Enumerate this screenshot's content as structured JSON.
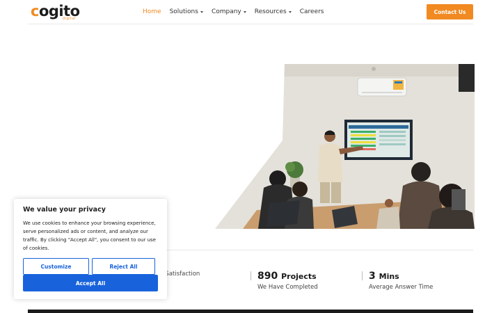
{
  "header": {
    "logo": "cogito",
    "logo_tag": "digital",
    "nav": [
      {
        "label": "Home",
        "active": true,
        "has_dropdown": false
      },
      {
        "label": "Solutions",
        "active": false,
        "has_dropdown": true
      },
      {
        "label": "Company",
        "active": false,
        "has_dropdown": true
      },
      {
        "label": "Resources",
        "active": false,
        "has_dropdown": true
      },
      {
        "label": "Careers",
        "active": false,
        "has_dropdown": false
      }
    ],
    "contact_label": "Contact Us"
  },
  "hero": {
    "image_icon": "office-meeting-photo"
  },
  "stats": [
    {
      "number": "",
      "unit": "",
      "label": "er Satisfaction"
    },
    {
      "number": "890",
      "unit": "Projects",
      "label": "We Have Completed"
    },
    {
      "number": "3",
      "unit": "Mins",
      "label": "Average Answer Time"
    }
  ],
  "cookie": {
    "title": "We value your privacy",
    "text": "We use cookies to enhance your browsing experience, serve personalized ads or content, and analyze our traffic. By clicking \"Accept All\", you consent to our use of cookies.",
    "customize_label": "Customize",
    "reject_label": "Reject All",
    "accept_label": "Accept All"
  },
  "colors": {
    "accent": "#f18a21",
    "cookie_blue": "#1863dc"
  }
}
